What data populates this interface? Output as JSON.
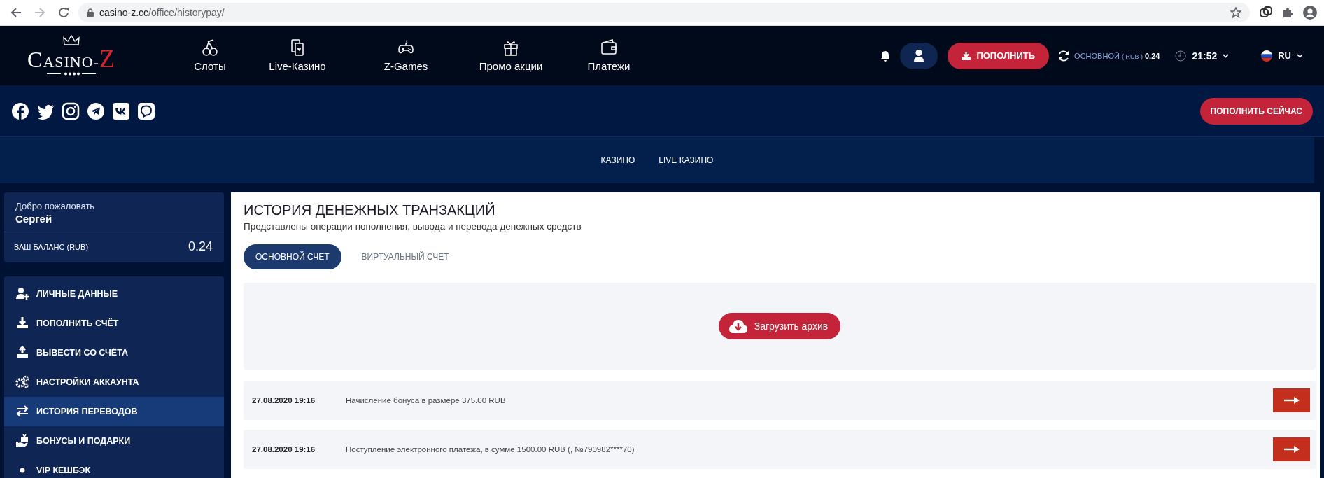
{
  "browser": {
    "url_host": "casino-z.cc",
    "url_path": "/office/historypay/",
    "forward_disabled": true
  },
  "header": {
    "logo": {
      "first": "C",
      "middle": "ASINO-",
      "last": "Z"
    },
    "nav": [
      {
        "label": "Слоты"
      },
      {
        "label": "Live-Казино"
      },
      {
        "label": "Z-Games"
      },
      {
        "label": "Промо акции"
      },
      {
        "label": "Платежи"
      }
    ],
    "deposit_button": "ПОПОЛНИТЬ",
    "account": "ОСНОВНОЙ",
    "currency": "( RUB )",
    "amount": "0.24",
    "time": "21:52",
    "language": "RU"
  },
  "deposit_now_button": "ПОПОЛНИТЬ СЕЙЧАС",
  "subnav": [
    {
      "label": "КАЗИНО"
    },
    {
      "label": "LIVE КАЗИНО"
    }
  ],
  "sidebar": {
    "welcome": "Добро пожаловать",
    "user": "Сергей",
    "balance_label": "ВАШ БАЛАНС (RUB)",
    "balance_value": "0.24",
    "menu": [
      {
        "label": "ЛИЧНЫЕ ДАННЫЕ",
        "selected": false
      },
      {
        "label": "ПОПОЛНИТЬ СЧЁТ",
        "selected": false
      },
      {
        "label": "ВЫВЕСТИ СО СЧЁТА",
        "selected": false
      },
      {
        "label": "НАСТРОЙКИ АККАУНТА",
        "selected": false
      },
      {
        "label": "ИСТОРИЯ ПЕРЕВОДОВ",
        "selected": true
      },
      {
        "label": "БОНУСЫ И ПОДАРКИ",
        "selected": false
      },
      {
        "label": "VIP КЕШБЭК",
        "selected": false
      }
    ]
  },
  "main": {
    "title": "ИСТОРИЯ ДЕНЕЖНЫХ ТРАНЗАКЦИЙ",
    "subtitle": "Представлены операции пополнения, вывода и перевода денежных средств",
    "tabs": [
      {
        "label": "ОСНОВНОЙ СЧЕТ",
        "selected": true
      },
      {
        "label": "ВИРТУАЛЬНЫЙ СЧЕТ",
        "selected": false
      }
    ],
    "archive_button": "Загрузить архив",
    "transactions": [
      {
        "date": "27.08.2020 19:16",
        "description": "Начисление бонуса в размере 375.00 RUB"
      },
      {
        "date": "27.08.2020 19:16",
        "description": "Поступление электронного платежа, в сумме 1500.00 RUB (, №790982****70)"
      }
    ]
  }
}
